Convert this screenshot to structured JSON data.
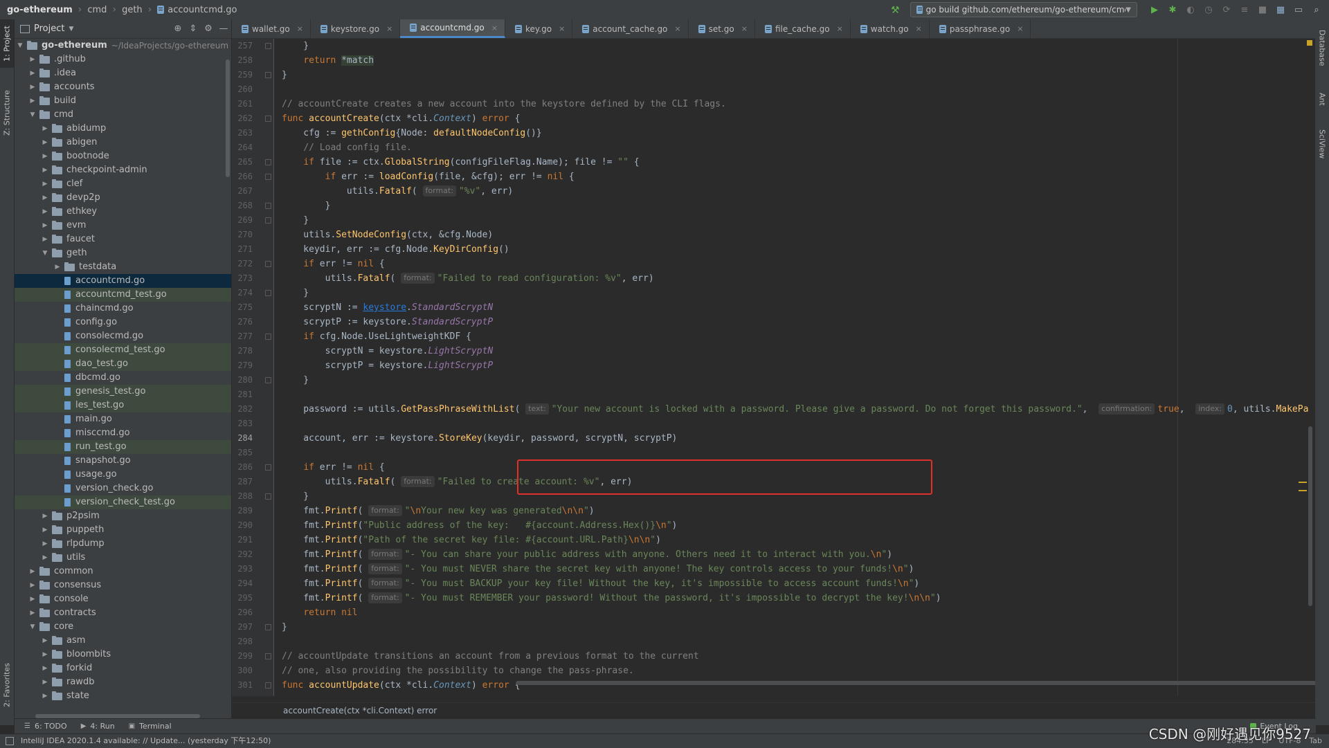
{
  "breadcrumb": {
    "project": "go-ethereum",
    "segments": [
      "cmd",
      "geth"
    ],
    "file": "accountcmd.go"
  },
  "run_config": {
    "label": "go build github.com/ethereum/go-ethereum/cmd/faucet"
  },
  "left_strip": {
    "project_tab": "1: Project",
    "structure_tab": "Z: Structure",
    "favorites_tab": "2: Favorites"
  },
  "right_strip": {
    "database_tab": "Database",
    "ant_tab": "Ant",
    "sciview_tab": "SciView"
  },
  "project_panel": {
    "title": "Project",
    "root": {
      "name": "go-ethereum",
      "path": "~/IdeaProjects/go-ethereum"
    },
    "tree": [
      {
        "name": ".github",
        "type": "folder",
        "level": 1,
        "expanded": false
      },
      {
        "name": ".idea",
        "type": "folder",
        "level": 1,
        "expanded": false
      },
      {
        "name": "accounts",
        "type": "folder",
        "level": 1,
        "expanded": false
      },
      {
        "name": "build",
        "type": "folder",
        "level": 1,
        "expanded": false
      },
      {
        "name": "cmd",
        "type": "folder",
        "level": 1,
        "expanded": true
      },
      {
        "name": "abidump",
        "type": "folder",
        "level": 2,
        "expanded": false
      },
      {
        "name": "abigen",
        "type": "folder",
        "level": 2,
        "expanded": false
      },
      {
        "name": "bootnode",
        "type": "folder",
        "level": 2,
        "expanded": false
      },
      {
        "name": "checkpoint-admin",
        "type": "folder",
        "level": 2,
        "expanded": false
      },
      {
        "name": "clef",
        "type": "folder",
        "level": 2,
        "expanded": false
      },
      {
        "name": "devp2p",
        "type": "folder",
        "level": 2,
        "expanded": false
      },
      {
        "name": "ethkey",
        "type": "folder",
        "level": 2,
        "expanded": false
      },
      {
        "name": "evm",
        "type": "folder",
        "level": 2,
        "expanded": false
      },
      {
        "name": "faucet",
        "type": "folder",
        "level": 2,
        "expanded": false
      },
      {
        "name": "geth",
        "type": "folder",
        "level": 2,
        "expanded": true
      },
      {
        "name": "testdata",
        "type": "folder",
        "level": 3,
        "expanded": false
      },
      {
        "name": "accountcmd.go",
        "type": "file",
        "level": 3,
        "selected": true
      },
      {
        "name": "accountcmd_test.go",
        "type": "file",
        "level": 3,
        "highlight": true
      },
      {
        "name": "chaincmd.go",
        "type": "file",
        "level": 3
      },
      {
        "name": "config.go",
        "type": "file",
        "level": 3
      },
      {
        "name": "consolecmd.go",
        "type": "file",
        "level": 3
      },
      {
        "name": "consolecmd_test.go",
        "type": "file",
        "level": 3,
        "highlight": true
      },
      {
        "name": "dao_test.go",
        "type": "file",
        "level": 3,
        "highlight": true
      },
      {
        "name": "dbcmd.go",
        "type": "file",
        "level": 3
      },
      {
        "name": "genesis_test.go",
        "type": "file",
        "level": 3,
        "highlight": true
      },
      {
        "name": "les_test.go",
        "type": "file",
        "level": 3,
        "highlight": true
      },
      {
        "name": "main.go",
        "type": "file",
        "level": 3
      },
      {
        "name": "misccmd.go",
        "type": "file",
        "level": 3
      },
      {
        "name": "run_test.go",
        "type": "file",
        "level": 3,
        "highlight": true
      },
      {
        "name": "snapshot.go",
        "type": "file",
        "level": 3
      },
      {
        "name": "usage.go",
        "type": "file",
        "level": 3
      },
      {
        "name": "version_check.go",
        "type": "file",
        "level": 3
      },
      {
        "name": "version_check_test.go",
        "type": "file",
        "level": 3,
        "highlight": true
      },
      {
        "name": "p2psim",
        "type": "folder",
        "level": 2,
        "expanded": false
      },
      {
        "name": "puppeth",
        "type": "folder",
        "level": 2,
        "expanded": false
      },
      {
        "name": "rlpdump",
        "type": "folder",
        "level": 2,
        "expanded": false
      },
      {
        "name": "utils",
        "type": "folder",
        "level": 2,
        "expanded": false
      },
      {
        "name": "common",
        "type": "folder",
        "level": 1,
        "expanded": false
      },
      {
        "name": "consensus",
        "type": "folder",
        "level": 1,
        "expanded": false
      },
      {
        "name": "console",
        "type": "folder",
        "level": 1,
        "expanded": false
      },
      {
        "name": "contracts",
        "type": "folder",
        "level": 1,
        "expanded": false
      },
      {
        "name": "core",
        "type": "folder",
        "level": 1,
        "expanded": true
      },
      {
        "name": "asm",
        "type": "folder",
        "level": 2,
        "expanded": false
      },
      {
        "name": "bloombits",
        "type": "folder",
        "level": 2,
        "expanded": false
      },
      {
        "name": "forkid",
        "type": "folder",
        "level": 2,
        "expanded": false
      },
      {
        "name": "rawdb",
        "type": "folder",
        "level": 2,
        "expanded": false
      },
      {
        "name": "state",
        "type": "folder",
        "level": 2,
        "expanded": false
      }
    ]
  },
  "tabs": [
    {
      "label": "wallet.go",
      "active": false
    },
    {
      "label": "keystore.go",
      "active": false
    },
    {
      "label": "accountcmd.go",
      "active": true
    },
    {
      "label": "key.go",
      "active": false
    },
    {
      "label": "account_cache.go",
      "active": false
    },
    {
      "label": "set.go",
      "active": false
    },
    {
      "label": "file_cache.go",
      "active": false
    },
    {
      "label": "watch.go",
      "active": false
    },
    {
      "label": "passphrase.go",
      "active": false
    }
  ],
  "editor": {
    "current_line": 284,
    "lines": [
      {
        "n": 257,
        "html": "    }"
      },
      {
        "n": 258,
        "html": "    <span class=\"kw\">return</span> <span class=\"hl-bg\">*match</span>"
      },
      {
        "n": 259,
        "html": "}"
      },
      {
        "n": 260,
        "html": ""
      },
      {
        "n": 261,
        "html": "<span class=\"cmt\">// accountCreate creates a new account into the keystore defined by the CLI flags.</span>"
      },
      {
        "n": 262,
        "html": "<span class=\"kw\">func</span> <span class=\"fn\">accountCreate</span>(ctx *<span class=\"pkg\">cli</span>.<span class=\"typ\">Context</span>) <span class=\"kw\">error</span> {"
      },
      {
        "n": 263,
        "html": "    cfg := <span class=\"fn\">gethConfig</span>{Node: <span class=\"fn\">defaultNodeConfig</span>()}"
      },
      {
        "n": 264,
        "html": "    <span class=\"cmt\">// Load config file.</span>"
      },
      {
        "n": 265,
        "html": "    <span class=\"kw\">if</span> file := ctx.<span class=\"fn\">GlobalString</span>(configFileFlag.Name); file != <span class=\"str\">\"\"</span> {"
      },
      {
        "n": 266,
        "html": "        <span class=\"kw\">if</span> err := <span class=\"fn\">loadConfig</span>(file, &amp;cfg); err != <span class=\"kw\">nil</span> {"
      },
      {
        "n": 267,
        "html": "            utils.<span class=\"fn\">Fatalf</span>( <span class=\"hint\">format:</span><span class=\"str\">\"%v\"</span>, err)"
      },
      {
        "n": 268,
        "html": "        }"
      },
      {
        "n": 269,
        "html": "    }"
      },
      {
        "n": 270,
        "html": "    utils.<span class=\"fn\">SetNodeConfig</span>(ctx, &amp;cfg.Node)"
      },
      {
        "n": 271,
        "html": "    keydir, err := cfg.Node.<span class=\"fn\">KeyDirConfig</span>()"
      },
      {
        "n": 272,
        "html": "    <span class=\"kw\">if</span> err != <span class=\"kw\">nil</span> {"
      },
      {
        "n": 273,
        "html": "        utils.<span class=\"fn\">Fatalf</span>( <span class=\"hint\">format:</span><span class=\"str\">\"Failed to read configuration: %v\"</span>, err)"
      },
      {
        "n": 274,
        "html": "    }"
      },
      {
        "n": 275,
        "html": "    scryptN := <span class=\"link\">keystore</span>.<span class=\"itl\">StandardScryptN</span>"
      },
      {
        "n": 276,
        "html": "    scryptP := keystore.<span class=\"itl\">StandardScryptP</span>"
      },
      {
        "n": 277,
        "html": "    <span class=\"kw\">if</span> cfg.Node.UseLightweightKDF {"
      },
      {
        "n": 278,
        "html": "        scryptN = keystore.<span class=\"itl\">LightScryptN</span>"
      },
      {
        "n": 279,
        "html": "        scryptP = keystore.<span class=\"itl\">LightScryptP</span>"
      },
      {
        "n": 280,
        "html": "    }"
      },
      {
        "n": 281,
        "html": ""
      },
      {
        "n": 282,
        "html": "    password := utils.<span class=\"fn\">GetPassPhraseWithList</span>( <span class=\"hint\">text:</span><span class=\"str\">\"Your new account is locked with a password. Please give a password. Do not forget this password.\"</span>,  <span class=\"hint\">confirmation:</span><span class=\"kw\">true</span>,  <span class=\"hint\">index:</span><span class=\"num\">0</span>, utils.<span class=\"fn\">MakePa</span>"
      },
      {
        "n": 283,
        "html": ""
      },
      {
        "n": 284,
        "html": "    account, err := keystore.<span class=\"fn\">StoreKey</span>(keydir, password, scryptN, scryptP)"
      },
      {
        "n": 285,
        "html": ""
      },
      {
        "n": 286,
        "html": "    <span class=\"kw\">if</span> err != <span class=\"kw\">nil</span> {"
      },
      {
        "n": 287,
        "html": "        utils.<span class=\"fn\">Fatalf</span>( <span class=\"hint\">format:</span><span class=\"str\">\"Failed to create account: %v\"</span>, err)"
      },
      {
        "n": 288,
        "html": "    }"
      },
      {
        "n": 289,
        "html": "    fmt.<span class=\"fn\">Printf</span>( <span class=\"hint\">format:</span><span class=\"str\">\"<span class=\"kw\">\\n</span>Your new key was generated<span class=\"kw\">\\n\\n</span>\"</span>)"
      },
      {
        "n": 290,
        "html": "    fmt.<span class=\"fn\">Printf</span>(<span class=\"str\">\"Public address of the key:   #{account.Address.Hex()}<span class=\"kw\">\\n</span>\"</span>)"
      },
      {
        "n": 291,
        "html": "    fmt.<span class=\"fn\">Printf</span>(<span class=\"str\">\"Path of the secret key file: #{account.URL.Path}<span class=\"kw\">\\n\\n</span>\"</span>)"
      },
      {
        "n": 292,
        "html": "    fmt.<span class=\"fn\">Printf</span>( <span class=\"hint\">format:</span><span class=\"str\">\"- You can share your public address with anyone. Others need it to interact with you.<span class=\"kw\">\\n</span>\"</span>)"
      },
      {
        "n": 293,
        "html": "    fmt.<span class=\"fn\">Printf</span>( <span class=\"hint\">format:</span><span class=\"str\">\"- You must NEVER share the secret key with anyone! The key controls access to your funds!<span class=\"kw\">\\n</span>\"</span>)"
      },
      {
        "n": 294,
        "html": "    fmt.<span class=\"fn\">Printf</span>( <span class=\"hint\">format:</span><span class=\"str\">\"- You must BACKUP your key file! Without the key, it's impossible to access account funds!<span class=\"kw\">\\n</span>\"</span>)"
      },
      {
        "n": 295,
        "html": "    fmt.<span class=\"fn\">Printf</span>( <span class=\"hint\">format:</span><span class=\"str\">\"- You must REMEMBER your password! Without the password, it's impossible to decrypt the key!<span class=\"kw\">\\n\\n</span>\"</span>)"
      },
      {
        "n": 296,
        "html": "    <span class=\"kw\">return nil</span>"
      },
      {
        "n": 297,
        "html": "}"
      },
      {
        "n": 298,
        "html": ""
      },
      {
        "n": 299,
        "html": "<span class=\"cmt\">// accountUpdate transitions an account from a previous format to the current</span>"
      },
      {
        "n": 300,
        "html": "<span class=\"cmt\">// one, also providing the possibility to change the pass-phrase.</span>"
      },
      {
        "n": 301,
        "html": "<span class=\"kw\">func</span> <span class=\"fn\">accountUpdate</span>(ctx *<span class=\"pkg\">cli</span>.<span class=\"typ\">Context</span>) <span class=\"kw\">error</span> {"
      },
      {
        "n": 302,
        "html": ""
      }
    ],
    "fold_lines": [
      257,
      259,
      262,
      265,
      266,
      268,
      269,
      272,
      274,
      277,
      280,
      286,
      288,
      297,
      299,
      301
    ]
  },
  "editor_breadcrumb": "accountCreate(ctx *cli.Context) error",
  "bottom_tools": {
    "todo": "6: TODO",
    "run": "4: Run",
    "terminal": "Terminal",
    "event_log": "Event Log"
  },
  "status": {
    "message": "IntelliJ IDEA 2020.1.4 available: // Update... (yesterday 下午12:50)",
    "position": "284:35",
    "line_sep": "LF",
    "encoding": "UTF-8",
    "indent": "Tab"
  },
  "watermark": "CSDN @刚好遇见你9527",
  "colors": {
    "keyword": "#cc7832",
    "function": "#ffc66d",
    "string": "#6a8759",
    "comment": "#808080",
    "highlight_box": "#e0302a",
    "selection": "#0d293e"
  }
}
